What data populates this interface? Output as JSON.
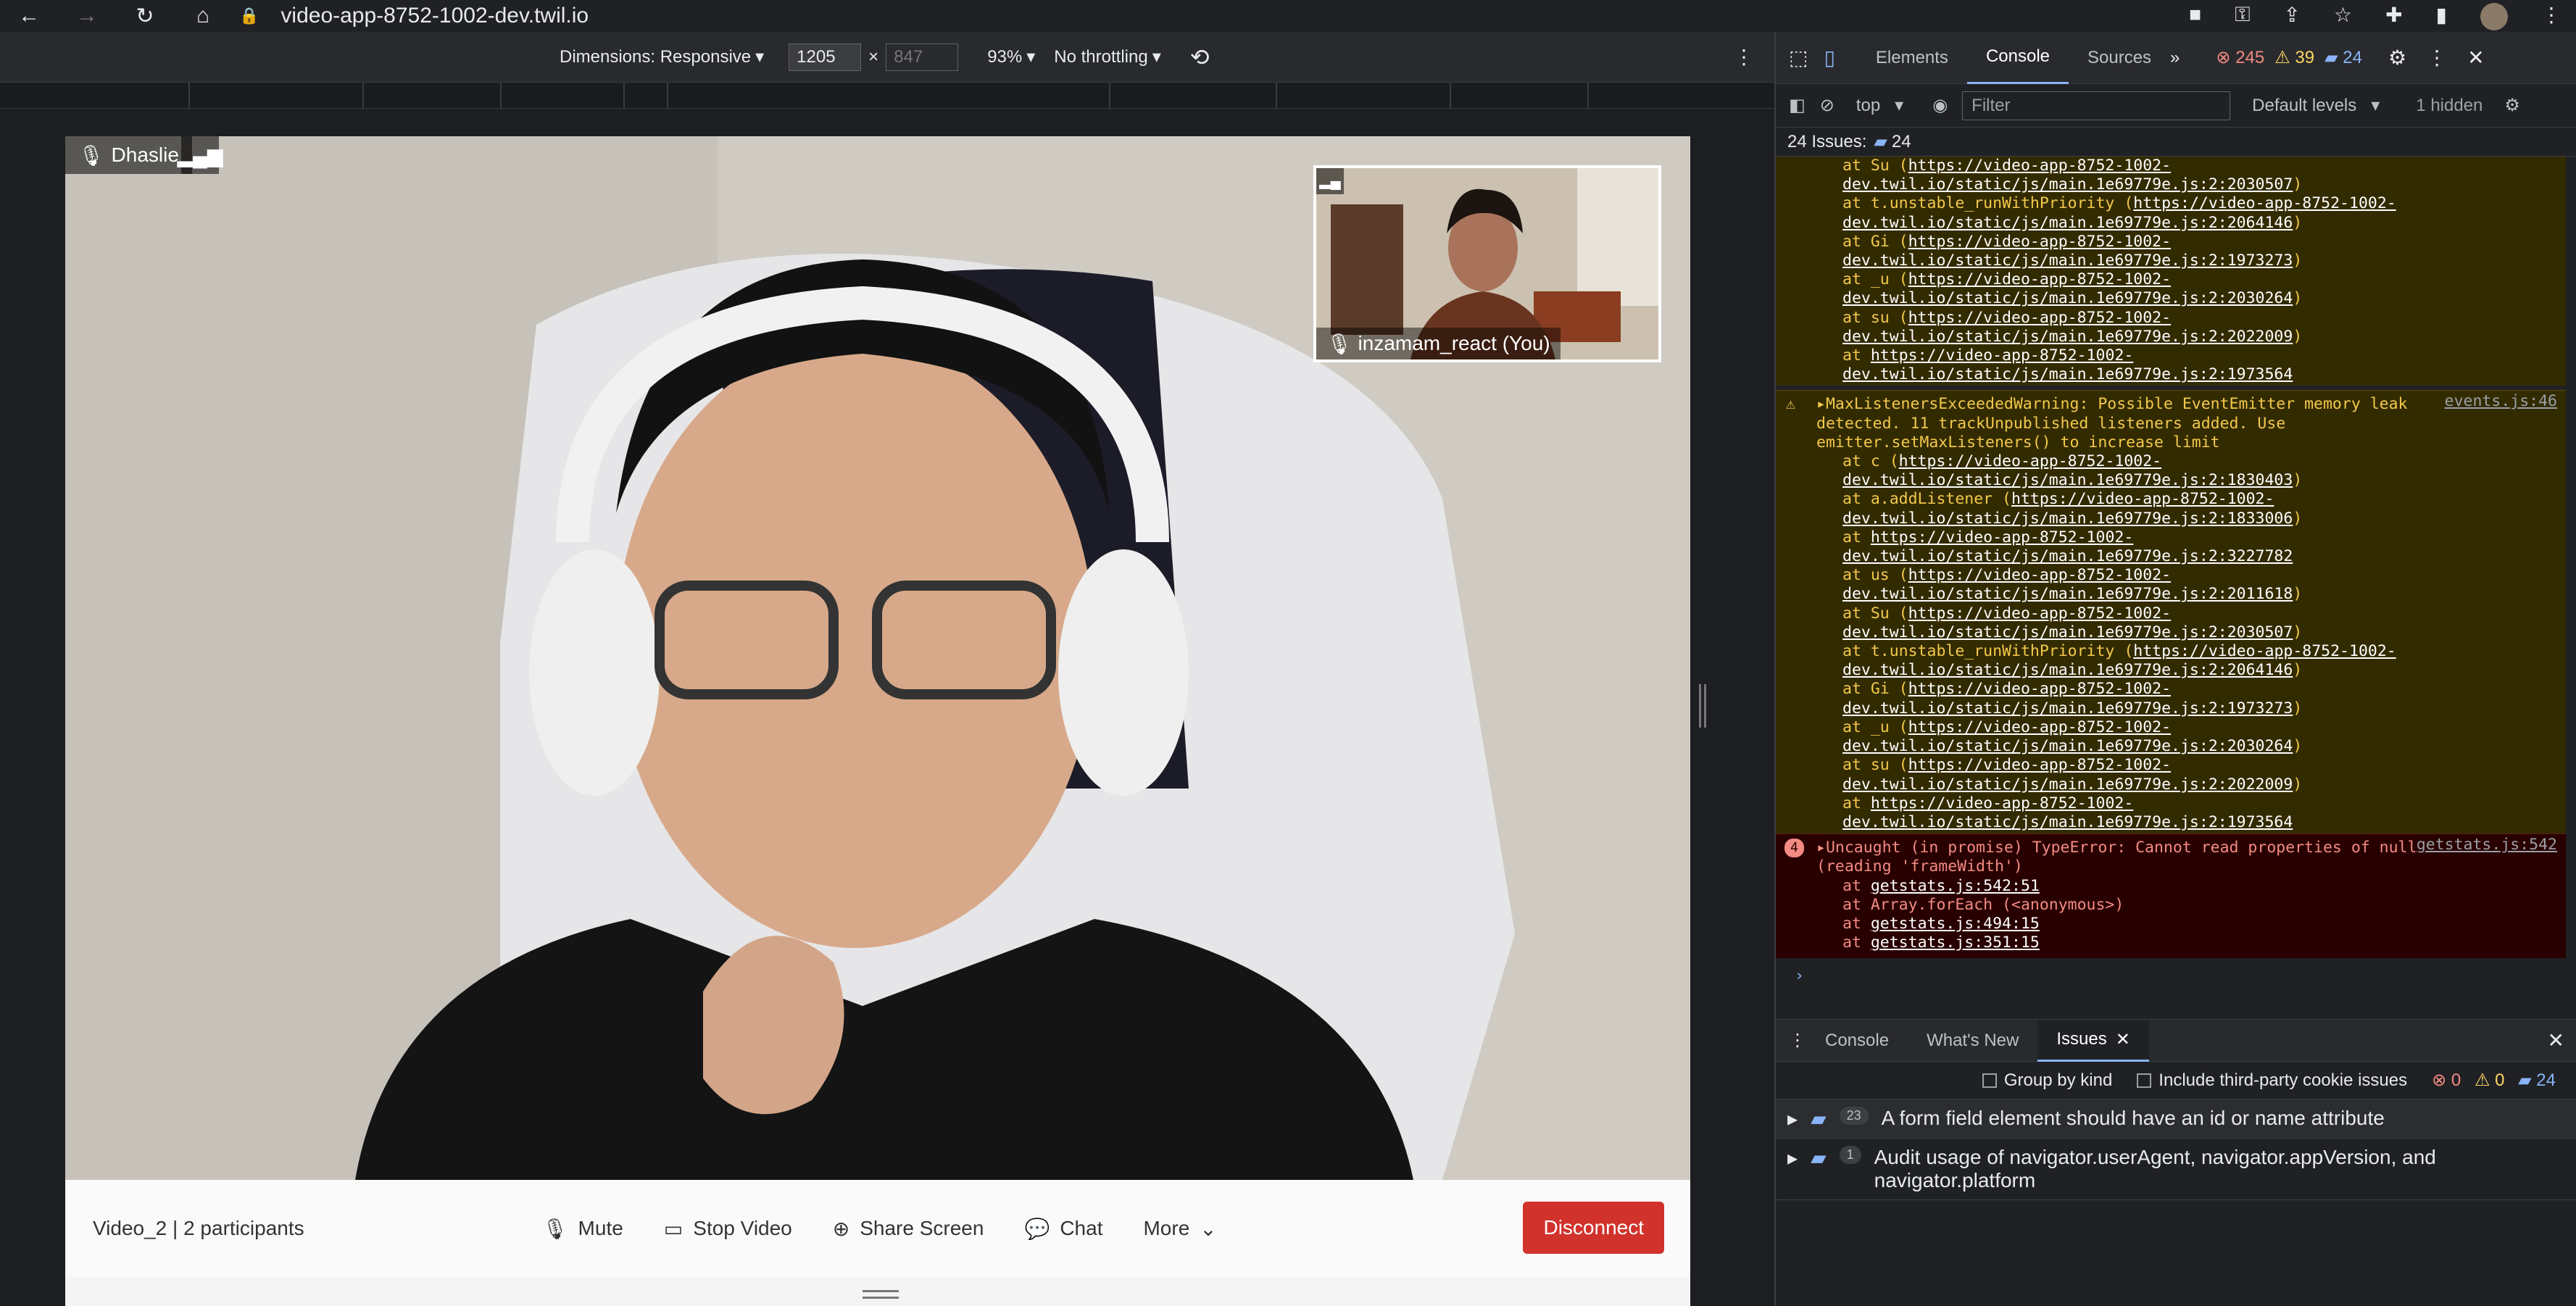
{
  "browser": {
    "url": "video-app-8752-1002-dev.twil.io"
  },
  "devbar": {
    "dimensions": "Dimensions: Responsive",
    "width": "1205",
    "height": "847",
    "zoom": "93%",
    "throttle": "No throttling"
  },
  "video": {
    "main_participant": "Dhaslie",
    "local_participant": "inzamam_react (You)",
    "room_info": "Video_2 | 2 participants",
    "mute": "Mute",
    "stop_video": "Stop Video",
    "share_screen": "Share Screen",
    "chat": "Chat",
    "more": "More",
    "disconnect": "Disconnect"
  },
  "devtools": {
    "tabs": [
      "Elements",
      "Console",
      "Sources"
    ],
    "active_tab": "Console",
    "errors": "245",
    "warnings": "39",
    "info": "24",
    "context": "top",
    "filter_placeholder": "Filter",
    "levels": "Default levels",
    "hidden": "1 hidden",
    "issues_label": "24 Issues:",
    "issues_count": "24",
    "pre_stack": [
      {
        "fn": "at Su (",
        "url": "https://video-app-8752-1002-dev.twil.io/static/js/main.1e69779e.js:2:2030507",
        "end": ")"
      },
      {
        "fn": "at t.unstable_runWithPriority (",
        "url": "https://video-app-8752-1002-dev.twil.io/static/js/main.1e69779e.js:2:2064146",
        "end": ")"
      },
      {
        "fn": "at Gi (",
        "url": "https://video-app-8752-1002-dev.twil.io/static/js/main.1e69779e.js:2:1973273",
        "end": ")"
      },
      {
        "fn": "at _u (",
        "url": "https://video-app-8752-1002-dev.twil.io/static/js/main.1e69779e.js:2:2030264",
        "end": ")"
      },
      {
        "fn": "at su (",
        "url": "https://video-app-8752-1002-dev.twil.io/static/js/main.1e69779e.js:2:2022009",
        "end": ")"
      },
      {
        "fn": "at ",
        "url": "https://video-app-8752-1002-dev.twil.io/static/js/main.1e69779e.js:2:1973564",
        "end": ""
      }
    ],
    "warning": {
      "text": "MaxListenersExceededWarning: Possible EventEmitter memory leak detected. 11 trackUnpublished listeners added. Use emitter.setMaxListeners() to increase limit",
      "source": "events.js:46",
      "stack": [
        {
          "fn": "at c (",
          "url": "https://video-app-8752-1002-dev.twil.io/static/js/main.1e69779e.js:2:1830403",
          "end": ")"
        },
        {
          "fn": "at a.addListener (",
          "url": "https://video-app-8752-1002-dev.twil.io/static/js/main.1e69779e.js:2:1833006",
          "end": ")"
        },
        {
          "fn": "at ",
          "url": "https://video-app-8752-1002-dev.twil.io/static/js/main.1e69779e.js:2:3227782",
          "end": ""
        },
        {
          "fn": "at us (",
          "url": "https://video-app-8752-1002-dev.twil.io/static/js/main.1e69779e.js:2:2011618",
          "end": ")"
        },
        {
          "fn": "at Su (",
          "url": "https://video-app-8752-1002-dev.twil.io/static/js/main.1e69779e.js:2:2030507",
          "end": ")"
        },
        {
          "fn": "at t.unstable_runWithPriority (",
          "url": "https://video-app-8752-1002-dev.twil.io/static/js/main.1e69779e.js:2:2064146",
          "end": ")"
        },
        {
          "fn": "at Gi (",
          "url": "https://video-app-8752-1002-dev.twil.io/static/js/main.1e69779e.js:2:1973273",
          "end": ")"
        },
        {
          "fn": "at _u (",
          "url": "https://video-app-8752-1002-dev.twil.io/static/js/main.1e69779e.js:2:2030264",
          "end": ")"
        },
        {
          "fn": "at su (",
          "url": "https://video-app-8752-1002-dev.twil.io/static/js/main.1e69779e.js:2:2022009",
          "end": ")"
        },
        {
          "fn": "at ",
          "url": "https://video-app-8752-1002-dev.twil.io/static/js/main.1e69779e.js:2:1973564",
          "end": ""
        }
      ]
    },
    "error": {
      "count": "4",
      "text": "Uncaught (in promise) TypeError: Cannot read properties of null (reading 'frameWidth')",
      "source": "getstats.js:542",
      "stack": [
        {
          "fn": "at ",
          "url": "getstats.js:542:51",
          "end": ""
        },
        {
          "fn": "at Array.forEach (<anonymous>)",
          "url": "",
          "end": ""
        },
        {
          "fn": "at ",
          "url": "getstats.js:494:15",
          "end": ""
        },
        {
          "fn": "at ",
          "url": "getstats.js:351:15",
          "end": ""
        }
      ]
    },
    "drawer_tabs": [
      "Console",
      "What's New",
      "Issues"
    ],
    "drawer_active": "Issues",
    "group_by_kind": "Group by kind",
    "third_party": "Include third-party cookie issues",
    "drawer_counts": {
      "errors": "0",
      "warnings": "0",
      "info": "24"
    },
    "issues": [
      {
        "count": "23",
        "text": "A form field element should have an id or name attribute"
      },
      {
        "count": "1",
        "text": "Audit usage of navigator.userAgent, navigator.appVersion, and navigator.platform"
      }
    ]
  }
}
